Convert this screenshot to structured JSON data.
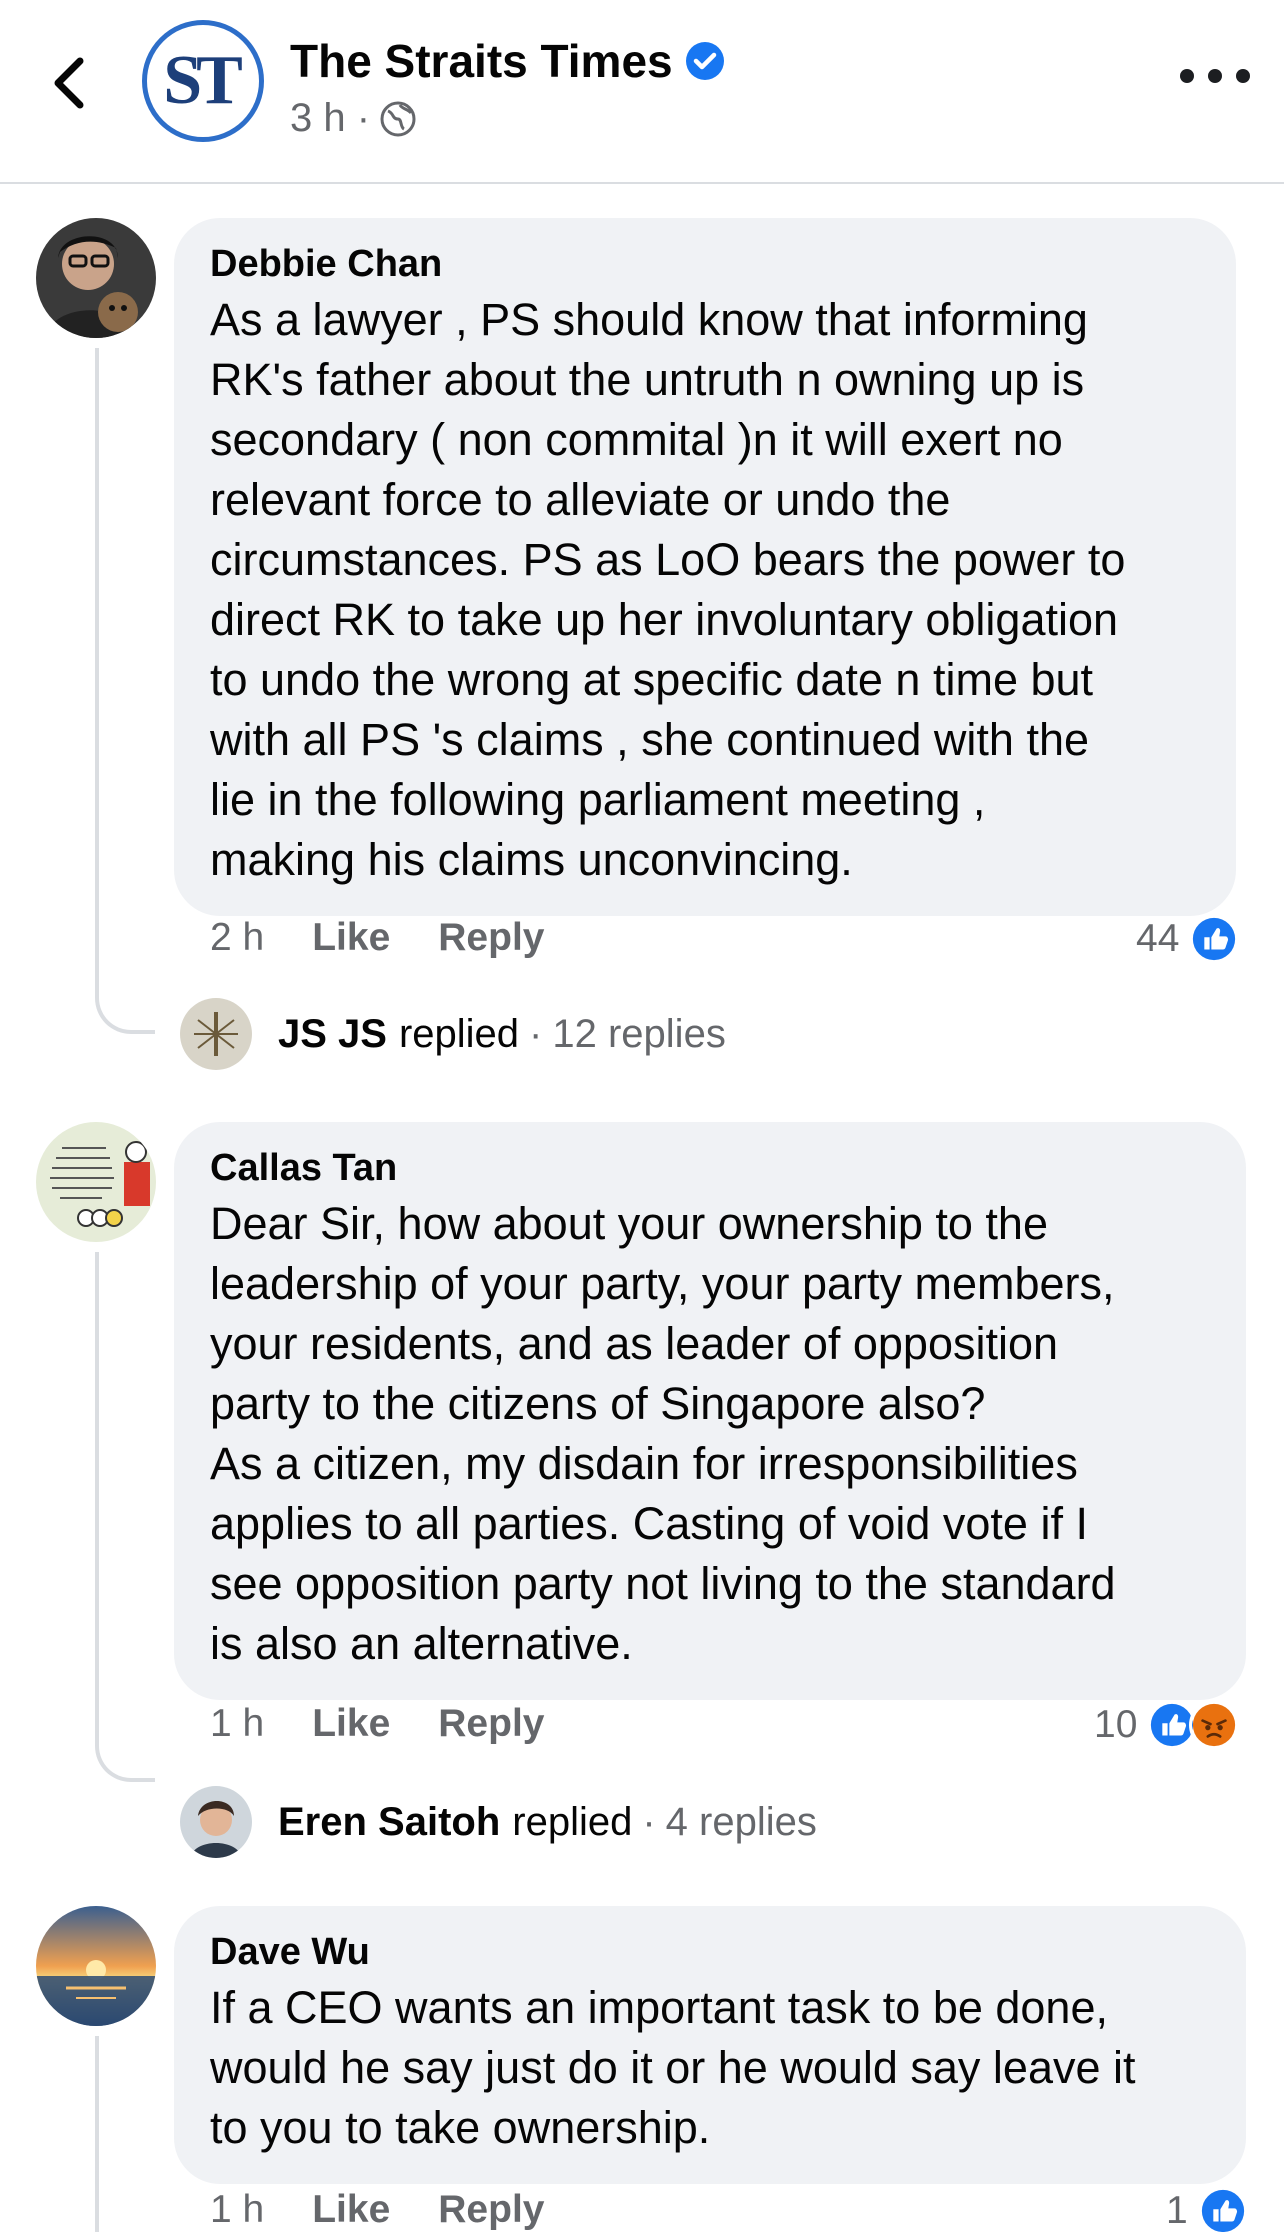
{
  "header": {
    "page_name": "The Straits Times",
    "logo_text": "ST",
    "post_time": "3 h ·",
    "icons": {
      "back": "chevron-left-icon",
      "verified": "verified-badge-icon",
      "globe": "globe-icon",
      "more": "more-icon"
    },
    "colors": {
      "brand": "#2d6ec9",
      "verified": "#1877f2"
    }
  },
  "comments": [
    {
      "author": "Debbie Chan",
      "text": "As a lawyer , PS should know that informing\nRK's father about the untruth n owning up is\nsecondary ( non commital )n it will exert no\nrelevant force to alleviate or undo the\ncircumstances. PS as LoO bears the power to\ndirect RK to take up her involuntary obligation\nto undo the wrong at specific date n time but\nwith all PS 's claims , she continued with the\nlie in the following parliament meeting ,\nmaking his claims unconvincing.",
      "time": "2 h",
      "like_label": "Like",
      "reply_label": "Reply",
      "reaction_count": "44",
      "reactions": [
        "like"
      ],
      "replied": {
        "name": "JS JS",
        "replied_word": "replied",
        "sep": "·",
        "replies": "12 replies"
      }
    },
    {
      "author": "Callas Tan",
      "text": "Dear Sir, how about your ownership to the\nleadership of your party, your party members,\nyour residents, and as leader of opposition\nparty to the citizens of Singapore also?\nAs a citizen, my disdain for irresponsibilities\napplies to all parties. Casting of void vote if I\nsee opposition party not living to the standard\nis also an alternative.",
      "time": "1 h",
      "like_label": "Like",
      "reply_label": "Reply",
      "reaction_count": "10",
      "reactions": [
        "like",
        "angry"
      ],
      "replied": {
        "name": "Eren Saitoh",
        "replied_word": "replied",
        "sep": "·",
        "replies": "4 replies"
      }
    },
    {
      "author": "Dave Wu",
      "text": "If a CEO wants an important task to be done,\nwould he say just do it or he would say leave it\nto you to take ownership.",
      "time": "1 h",
      "like_label": "Like",
      "reply_label": "Reply",
      "reaction_count": "1",
      "reactions": [
        "like"
      ]
    }
  ],
  "colors": {
    "bubble": "#f0f2f5",
    "secondary_text": "#65676b",
    "like_blue": "#1877f2",
    "angry_orange": "#e9710f"
  }
}
